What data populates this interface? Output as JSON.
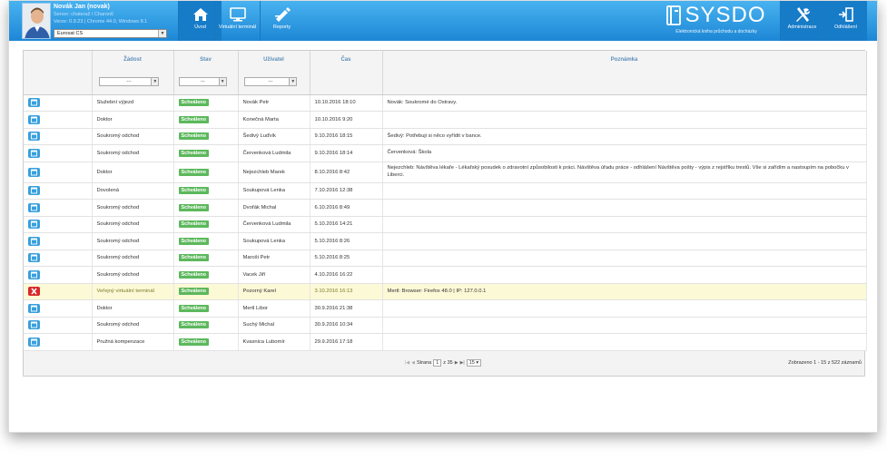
{
  "header": {
    "user_name": "Novák Jan (novak)",
    "server": "Server: chateraž / Charon6",
    "version": "Verze: 0.9.23 | Chrome 44.0, Windows 8.1",
    "company": "Eurosat CS",
    "nav": [
      {
        "label": "Úvod",
        "icon": "home-icon"
      },
      {
        "label": "Virtuální terminál",
        "icon": "monitor-icon"
      },
      {
        "label": "Reporty",
        "icon": "reports-icon"
      }
    ],
    "logo_text": "SYSDO",
    "logo_tagline": "Elektronická kniha průchodu a docházky",
    "admin": {
      "label": "Administrace",
      "icon": "tools-icon"
    },
    "logout": {
      "label": "Odhlášení",
      "icon": "logout-icon"
    }
  },
  "grid": {
    "columns": [
      "Žádost",
      "Stav",
      "Uživatel",
      "Čas",
      "Poznámka"
    ],
    "filter_placeholder": "---",
    "rows": [
      {
        "action": "calendar-icon",
        "request": "Služební výjezd",
        "status": "Schváleno",
        "user": "Novák Petr",
        "time": "10.10.2016 18:10",
        "note": "Novák: Soukromé do Ostravy."
      },
      {
        "action": "calendar-icon",
        "request": "Doktor",
        "status": "Schváleno",
        "user": "Konečná Marta",
        "time": "10.10.2016 9:20",
        "note": ""
      },
      {
        "action": "calendar-icon",
        "request": "Soukromý odchod",
        "status": "Schváleno",
        "user": "Šedivý Luďvík",
        "time": "9.10.2016 18:15",
        "note": "Šedivý: Potřebuji si něco vyřídit v bance."
      },
      {
        "action": "calendar-icon",
        "request": "Soukromý odchod",
        "status": "Schváleno",
        "user": "Červenková Ludmila",
        "time": "9.10.2016 18:14",
        "note": "Červenková: Škola"
      },
      {
        "action": "calendar-icon",
        "request": "Doktor",
        "status": "Schváleno",
        "user": "Nejezchleb Marek",
        "time": "8.10.2016 8:42",
        "note": "Nejezchleb: Návštěva lékaře - Lékařský posudek o zdravotní způsobilosti k práci. Návštěva úřadu práce - odhlášení Návštěva pošty - výpis z rejstříku trestů. Vše si zařídím a nastoupím na pobočku v Liberci."
      },
      {
        "action": "calendar-icon",
        "request": "Dovolená",
        "status": "Schváleno",
        "user": "Soukupová Lenka",
        "time": "7.10.2016 12:38",
        "note": ""
      },
      {
        "action": "calendar-icon",
        "request": "Soukromý odchod",
        "status": "Schváleno",
        "user": "Dvořák Michal",
        "time": "6.10.2016 8:49",
        "note": ""
      },
      {
        "action": "calendar-icon",
        "request": "Soukromý odchod",
        "status": "Schváleno",
        "user": "Červenková Ludmila",
        "time": "5.10.2016 14:21",
        "note": ""
      },
      {
        "action": "calendar-icon",
        "request": "Soukromý odchod",
        "status": "Schváleno",
        "user": "Soukupová Lenka",
        "time": "5.10.2016 8:26",
        "note": ""
      },
      {
        "action": "calendar-icon",
        "request": "Soukromý odchod",
        "status": "Schváleno",
        "user": "Maroši Petr",
        "time": "5.10.2016 8:25",
        "note": ""
      },
      {
        "action": "calendar-icon",
        "request": "Soukromý odchod",
        "status": "Schváleno",
        "user": "Vacek Jiří",
        "time": "4.10.2016 16:22",
        "note": ""
      },
      {
        "action": "delete-icon",
        "request": "Veřejný virtuální terminál",
        "status": "Schváleno",
        "user": "Pozorný Karel",
        "time": "3.10.2016 16:13",
        "note": "Mertl: Browser: Firefox 48.0 | IP: 127.0.0.1"
      },
      {
        "action": "calendar-icon",
        "request": "Doktor",
        "status": "Schváleno",
        "user": "Mertl Libor",
        "time": "30.9.2016 21:38",
        "note": ""
      },
      {
        "action": "calendar-icon",
        "request": "Soukromý odchod",
        "status": "Schváleno",
        "user": "Suchý Michal",
        "time": "30.9.2016 10:34",
        "note": ""
      },
      {
        "action": "calendar-icon",
        "request": "Pružná kompenzace",
        "status": "Schváleno",
        "user": "Kvasnica Lubomír",
        "time": "29.9.2016 17:18",
        "note": ""
      }
    ]
  },
  "pager": {
    "page_label": "Strana",
    "page": "1",
    "of_label": "z 35",
    "page_size": "15",
    "summary": "Zobrazeno 1 - 15 z 522 záznamů"
  },
  "colors": {
    "header_top": "#49b2f0",
    "header_bottom": "#1d87d6",
    "approved": "#5cb85c",
    "action_blue": "#38a0de",
    "delete_red": "#d9292b",
    "highlight": "#fcf9d6"
  }
}
